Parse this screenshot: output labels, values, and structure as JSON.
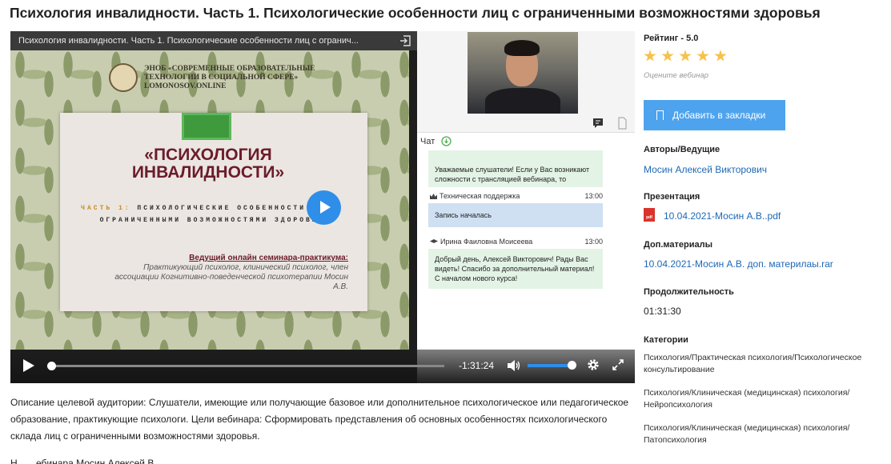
{
  "page": {
    "title": "Психология инвалидности. Часть 1. Психологические особенности лиц с ограниченными возможностями здоровья"
  },
  "player": {
    "topbar_title": "Психология инвалидности. Часть 1. Психологические особенности лиц с огранич...",
    "slide": {
      "org_name": "ЭНОБ «СОВРЕМЕННЫЕ ОБРАЗОВАТЕЛЬНЫЕ ТЕХНОЛОГИИ В СОЦИАЛЬНОЙ СФЕРЕ» LOMONOSOV.ONLINE",
      "heading": "«ПСИХОЛОГИЯ ИНВАЛИДНОСТИ»",
      "sub_part": "ЧАСТЬ 1:",
      "sub_text": "ПСИХОЛОГИЧЕСКИЕ ОСОБЕННОСТИ ЛИЦ С ОГРАНИЧЕННЫМИ ВОЗМОЖНОСТЯМИ ЗДОРОВЬЯ",
      "presenter_title": "Ведущий онлайн семинара-практикума:",
      "presenter_text": "Практикующий психолог, клинический психолог, член ассоциации Когнитивно-поведенческой психотерапии Мосин А.В."
    },
    "time_remaining": "-1:31:24",
    "progress": 0.0,
    "volume": 1.0,
    "accent_color": "#2f8ee8"
  },
  "chat": {
    "title": "Чат",
    "messages": [
      {
        "author": "",
        "time": "",
        "text": "Уважаемые слушатели! Если у Вас возникают сложности с трансляцией вебинара, то",
        "color": "#e3f3e6"
      },
      {
        "author": "Техническая поддержка",
        "time": "13:00",
        "text": "Запись началась",
        "color": "#cfe0f3"
      },
      {
        "author": "Ирина Фаиловна Моисеева",
        "time": "13:00",
        "text": "Добрый день, Алексей Викторович! Рады Вас видеть! Спасибо за дополнительный материал! С началом нового курса!",
        "color": "#e3f3e6"
      }
    ]
  },
  "sidebar": {
    "rating_label": "Рейтинг - 5.0",
    "rating_value": 5,
    "rate_hint": "Оцените вебинар",
    "bookmark_label": "Добавить в закладки",
    "authors_heading": "Авторы/Ведущие",
    "author_name": "Мосин Алексей Викторович",
    "presentation_heading": "Презентация",
    "presentation_file": "10.04.2021-Мосин А.В..pdf",
    "pdf_badge": "pdf",
    "materials_heading": "Доп.материалы",
    "materials_file": "10.04.2021-Мосин А.В. доп. материлаы.rar",
    "duration_heading": "Продолжительность",
    "duration_value": "01:31:30",
    "categories_heading": "Категории",
    "categories": [
      "Психология/Практическая психология/Психологическое консультирование",
      "Психология/Клиническая (медицинская) психология/Нейропсихология",
      "Психология/Клиническая (медицинская) психология/Патопсихология"
    ]
  },
  "description": "Описание целевой аудитории: Слушатели, имеющие или получающие базовое или дополнительное психологическое или педагогическое образование, практикующие психологи. Цели вебинара: Сформировать представления об основных особенностях психологического склада лиц с ограниченными возможностями здоровья.",
  "bottom_text": "Н... ...ебинара Мосин Алексей В..."
}
